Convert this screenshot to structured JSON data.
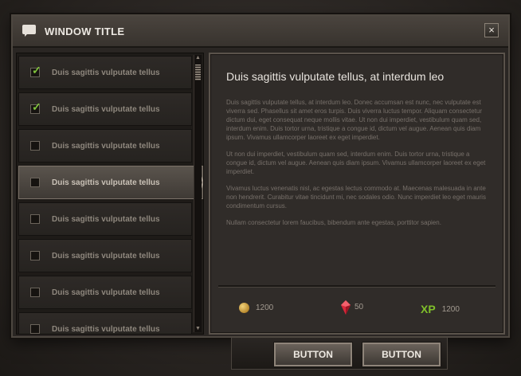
{
  "window": {
    "title": "WINDOW TITLE",
    "title_icon": "speech-bubble-icon",
    "close_glyph": "×"
  },
  "list": {
    "items": [
      {
        "label": "Duis sagittis vulputate tellus",
        "checked": true,
        "selected": false
      },
      {
        "label": "Duis sagittis vulputate tellus",
        "checked": true,
        "selected": false
      },
      {
        "label": "Duis sagittis vulputate tellus",
        "checked": false,
        "selected": false
      },
      {
        "label": "Duis sagittis vulputate tellus",
        "checked": false,
        "selected": true
      },
      {
        "label": "Duis sagittis vulputate tellus",
        "checked": false,
        "selected": false
      },
      {
        "label": "Duis sagittis vulputate tellus",
        "checked": false,
        "selected": false
      },
      {
        "label": "Duis sagittis vulputate tellus",
        "checked": false,
        "selected": false
      },
      {
        "label": "Duis sagittis vulputate tellus",
        "checked": false,
        "selected": false
      }
    ]
  },
  "detail": {
    "title": "Duis sagittis vulputate tellus, at interdum leo",
    "paragraphs": [
      "Duis sagittis vulputate tellus, at interdum leo. Donec accumsan est nunc, nec vulputate est viverra sed. Phasellus sit amet eros turpis. Duis viverra luctus tempor. Aliquam consectetur dictum dui, eget consequat neque mollis vitae. Ut non dui imperdiet, vestibulum quam sed, interdum enim. Duis tortor urna, tristique a congue id, dictum vel augue. Aenean quis diam ipsum. Vivamus ullamcorper laoreet ex eget imperdiet.",
      "Ut non dui imperdiet, vestibulum quam sed, interdum enim. Duis tortor urna, tristique a congue id, dictum vel augue. Aenean quis diam ipsum. Vivamus ullamcorper laoreet ex eget imperdiet.",
      "Vivamus luctus venenatis nisl, ac egestas lectus commodo at. Maecenas malesuada in ante non hendrerit. Curabitur vitae tincidunt mi, nec sodales odio. Nunc imperdiet leo eget mauris condimentum cursus.",
      "Nullam consectetur lorem faucibus, bibendum ante egestas, porttitor sapien."
    ],
    "rewards": {
      "gold": "1200",
      "gems": "50",
      "xp_label": "XP",
      "xp": "1200"
    }
  },
  "buttons": {
    "left_label": "BUTTON",
    "right_label": "BUTTON"
  },
  "colors": {
    "check_green": "#7fc23b",
    "xp_green": "#7fbf2a",
    "gem_red": "#d8283a",
    "gold": "#d9ad4a"
  }
}
